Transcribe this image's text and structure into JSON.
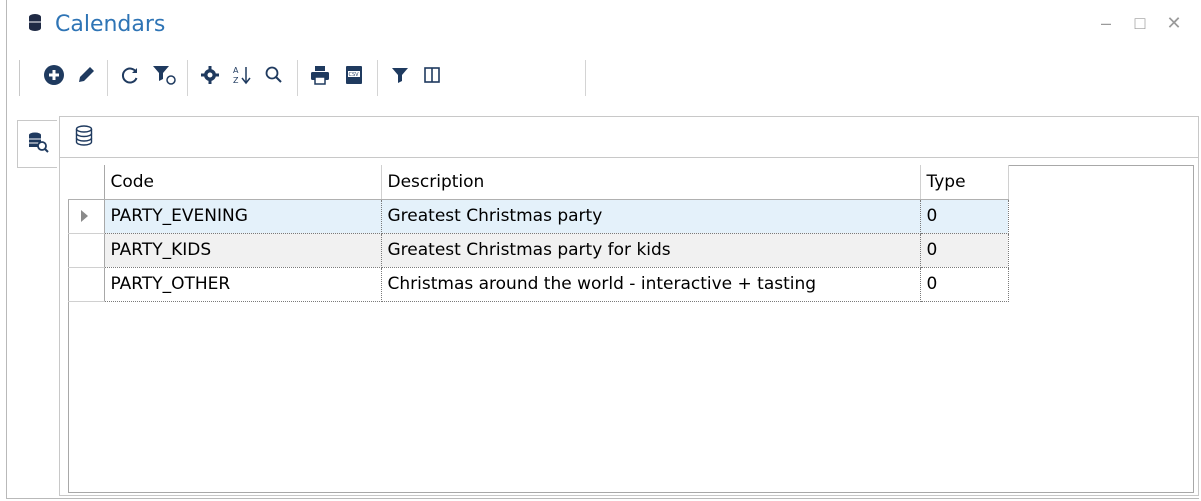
{
  "window": {
    "title": "Calendars",
    "controls": {
      "minimize": "–",
      "maximize": "□",
      "close": "✕"
    }
  },
  "toolbar": {
    "buttons": [
      {
        "icon": "add-circle-icon",
        "tooltip": ""
      },
      {
        "icon": "pencil-icon",
        "tooltip": ""
      },
      {
        "icon": "refresh-icon",
        "tooltip": ""
      },
      {
        "icon": "clear-filter-icon",
        "tooltip": ""
      },
      {
        "icon": "gear-icon",
        "tooltip": ""
      },
      {
        "icon": "sort-az-icon",
        "tooltip": ""
      },
      {
        "icon": "search-icon",
        "tooltip": ""
      },
      {
        "icon": "print-icon",
        "tooltip": ""
      },
      {
        "icon": "export-csv-icon",
        "tooltip": ""
      },
      {
        "icon": "filter-icon",
        "tooltip": ""
      },
      {
        "icon": "columns-icon",
        "tooltip": ""
      }
    ]
  },
  "grid": {
    "columns": [
      "Code",
      "Description",
      "Type"
    ],
    "rows": [
      {
        "code": "PARTY_EVENING",
        "description": "Greatest Christmas party",
        "type": "0"
      },
      {
        "code": "PARTY_KIDS",
        "description": "Greatest Christmas party for kids",
        "type": "0"
      },
      {
        "code": "PARTY_OTHER",
        "description": "Christmas around the world - interactive + tasting",
        "type": "0"
      }
    ],
    "selected_row": 0
  },
  "colors": {
    "accent": "#2e74b5",
    "selected_row": "#e4f1fa",
    "alt_row": "#f1f1f1",
    "icon": "#1f3a5f"
  }
}
